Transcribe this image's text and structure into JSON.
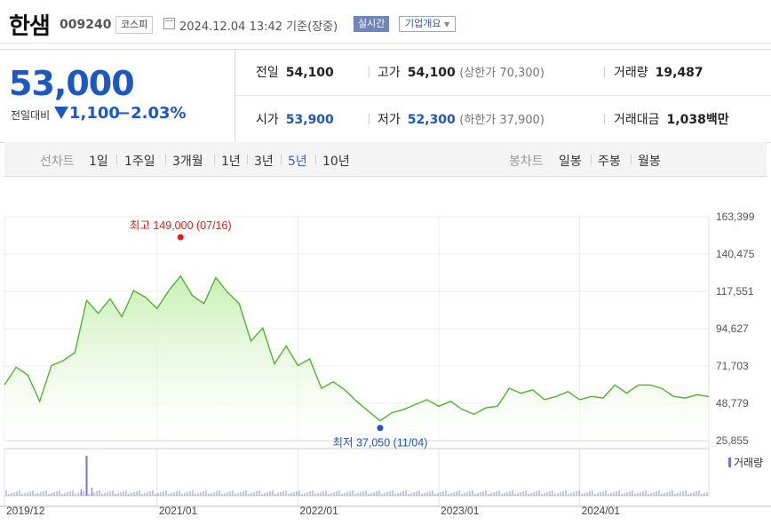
{
  "header": {
    "name": "한샘",
    "code": "009240",
    "market": "코스피",
    "datetime": "2024.12.04 13:42",
    "basis": "기준(장중)",
    "realtime": "실시간",
    "company_info": "기업개요"
  },
  "quote": {
    "price": "53,000",
    "change_label": "전일대비",
    "change": "1,100",
    "change_pct": "−2.03%",
    "prev_close_label": "전일",
    "prev_close": "54,100",
    "high_label": "고가",
    "high": "54,100",
    "upper_limit": "(상한가 70,300)",
    "volume_label": "거래량",
    "volume": "19,487",
    "open_label": "시가",
    "open": "53,900",
    "low_label": "저가",
    "low": "52,300",
    "lower_limit": "(하한가 37,900)",
    "value_label": "거래대금",
    "value": "1,038",
    "value_unit": "백만"
  },
  "nav": {
    "line_label": "선차트",
    "line_items": [
      "1일",
      "1주일",
      "3개월",
      "1년",
      "3년",
      "5년",
      "10년"
    ],
    "selected": "5년",
    "candle_label": "봉차트",
    "candle_items": [
      "일봉",
      "주봉",
      "월봉"
    ]
  },
  "colors": {
    "down": "#1c58c5",
    "up": "#e0201a",
    "area_stroke": "#4fb62b",
    "area_fill": "#c7f0b4"
  },
  "chart_data": {
    "type": "area",
    "ylim": [
      25855,
      163399
    ],
    "yticks": [
      "163,399",
      "140,475",
      "117,551",
      "94,627",
      "71,703",
      "48,779",
      "25,855"
    ],
    "xticks": [
      "2019/12",
      "2021/01",
      "2022/01",
      "2023/01",
      "2024/01"
    ],
    "x": [
      "2019-12",
      "2020-01",
      "2020-02",
      "2020-03",
      "2020-04",
      "2020-05",
      "2020-06",
      "2020-07",
      "2020-08",
      "2020-09",
      "2020-10",
      "2020-11",
      "2020-12",
      "2021-01",
      "2021-02",
      "2021-03",
      "2021-04",
      "2021-05",
      "2021-06",
      "2021-07",
      "2021-08",
      "2021-09",
      "2021-10",
      "2021-11",
      "2021-12",
      "2022-01",
      "2022-02",
      "2022-03",
      "2022-04",
      "2022-05",
      "2022-06",
      "2022-07",
      "2022-08",
      "2022-09",
      "2022-10",
      "2022-11",
      "2022-12",
      "2023-01",
      "2023-02",
      "2023-03",
      "2023-04",
      "2023-05",
      "2023-06",
      "2023-07",
      "2023-08",
      "2023-09",
      "2023-10",
      "2023-11",
      "2023-12",
      "2024-01",
      "2024-02",
      "2024-03",
      "2024-04",
      "2024-05",
      "2024-06",
      "2024-07",
      "2024-08",
      "2024-09",
      "2024-10",
      "2024-11",
      "2024-12"
    ],
    "values": [
      60000,
      71000,
      66000,
      50000,
      72000,
      75000,
      80000,
      112000,
      104000,
      113000,
      102000,
      118000,
      114000,
      107000,
      118000,
      127000,
      115000,
      110000,
      126000,
      117000,
      110000,
      87000,
      95000,
      73000,
      84000,
      72000,
      76000,
      58000,
      62000,
      57000,
      50000,
      44000,
      38000,
      43000,
      45000,
      48000,
      51000,
      47000,
      50000,
      45000,
      42000,
      46000,
      47000,
      58000,
      55000,
      57000,
      51000,
      53000,
      56000,
      51000,
      53000,
      52000,
      60000,
      55000,
      60000,
      60000,
      58000,
      53000,
      52000,
      54000,
      53000
    ],
    "max_label": "최고 149,000 (07/16)",
    "min_label": "최저 37,050 (11/04)",
    "volume_label": "거래량",
    "volume_spike_date": "2020-07"
  }
}
